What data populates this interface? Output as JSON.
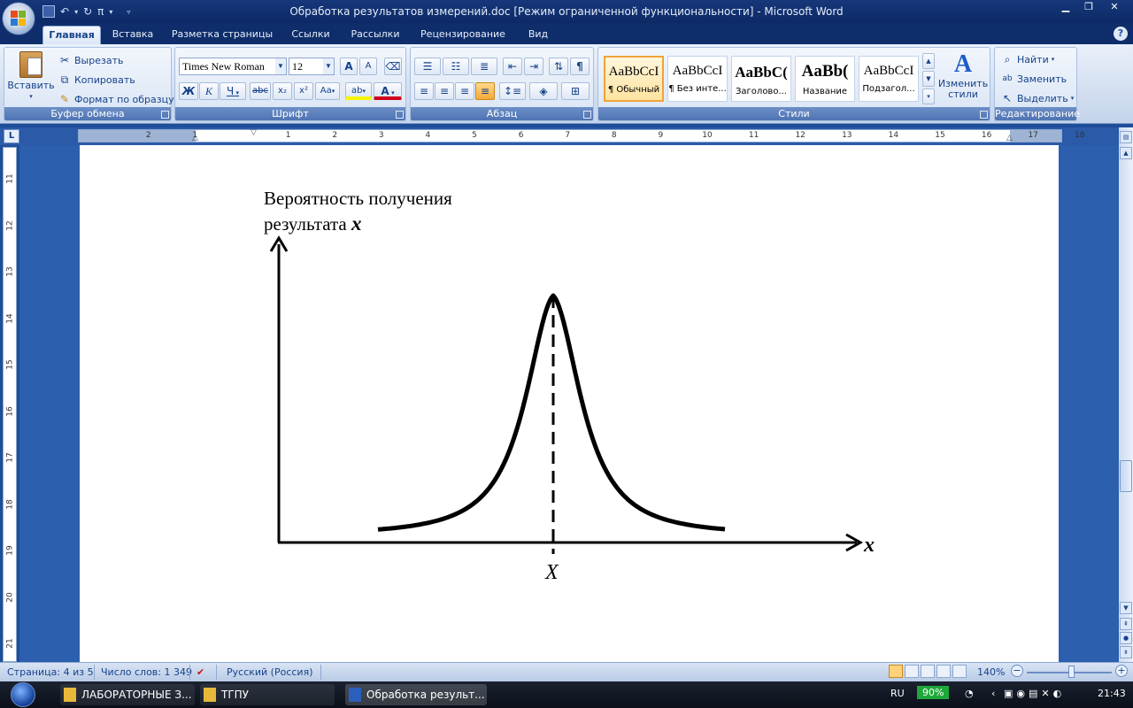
{
  "window": {
    "title": "Обработка результатов измерений.doc [Режим ограниченной функциональности] - Microsoft Word",
    "controls": {
      "minimize": "▁",
      "maximize": "❐",
      "close": "✕"
    }
  },
  "tabs": [
    "Главная",
    "Вставка",
    "Разметка страницы",
    "Ссылки",
    "Рассылки",
    "Рецензирование",
    "Вид"
  ],
  "active_tab": "Главная",
  "ribbon": {
    "clipboard": {
      "label": "Буфер обмена",
      "paste": "Вставить",
      "cut": "Вырезать",
      "copy": "Копировать",
      "format_painter": "Формат по образцу"
    },
    "font": {
      "label": "Шрифт",
      "font_name": "Times New Roman",
      "font_size": "12",
      "bold": "Ж",
      "italic": "К",
      "underline": "Ч",
      "strike": "abc",
      "subscript": "x₂",
      "superscript": "x²",
      "change_case": "Aa",
      "grow": "A",
      "shrink": "A",
      "highlight": "ab",
      "font_color": "A"
    },
    "paragraph": {
      "label": "Абзац",
      "pilcrow": "¶"
    },
    "styles": {
      "label": "Стили",
      "tiles": [
        {
          "preview": "AaBbCcI",
          "name": "¶ Обычный"
        },
        {
          "preview": "AaBbCcI",
          "name": "¶ Без инте..."
        },
        {
          "preview": "AaBbC(",
          "name": "Заголово..."
        },
        {
          "preview": "AaBb(",
          "name": "Название"
        },
        {
          "preview": "AaBbCcI",
          "name": "Подзагол..."
        }
      ],
      "change_styles": "Изменить стили"
    },
    "editing": {
      "label": "Редактирование",
      "find": "Найти",
      "replace": "Заменить",
      "select": "Выделить"
    }
  },
  "ruler": {
    "h_numbers": [
      "2",
      "1",
      "1",
      "2",
      "3",
      "4",
      "5",
      "6",
      "7",
      "8",
      "9",
      "10",
      "11",
      "12",
      "13",
      "14",
      "15",
      "16",
      "17",
      "18"
    ],
    "v_numbers": [
      "11",
      "12",
      "13",
      "14",
      "15",
      "16",
      "17",
      "18",
      "19",
      "20",
      "21"
    ]
  },
  "figure": {
    "ylabel_line1": "Вероятность получения",
    "ylabel_line2": "результата",
    "ylabel_var": "x",
    "xlabel": "x",
    "peak_label": "X"
  },
  "status": {
    "page": "Страница: 4 из 5",
    "words": "Число слов: 1 349",
    "language": "Русский (Россия)",
    "zoom": "140%"
  },
  "taskbar": {
    "items": [
      "ЛАБОРАТОРНЫЕ З...",
      "ТГПУ",
      "Обработка результ..."
    ],
    "lang": "RU",
    "battery": "90%",
    "time": "21:43"
  }
}
